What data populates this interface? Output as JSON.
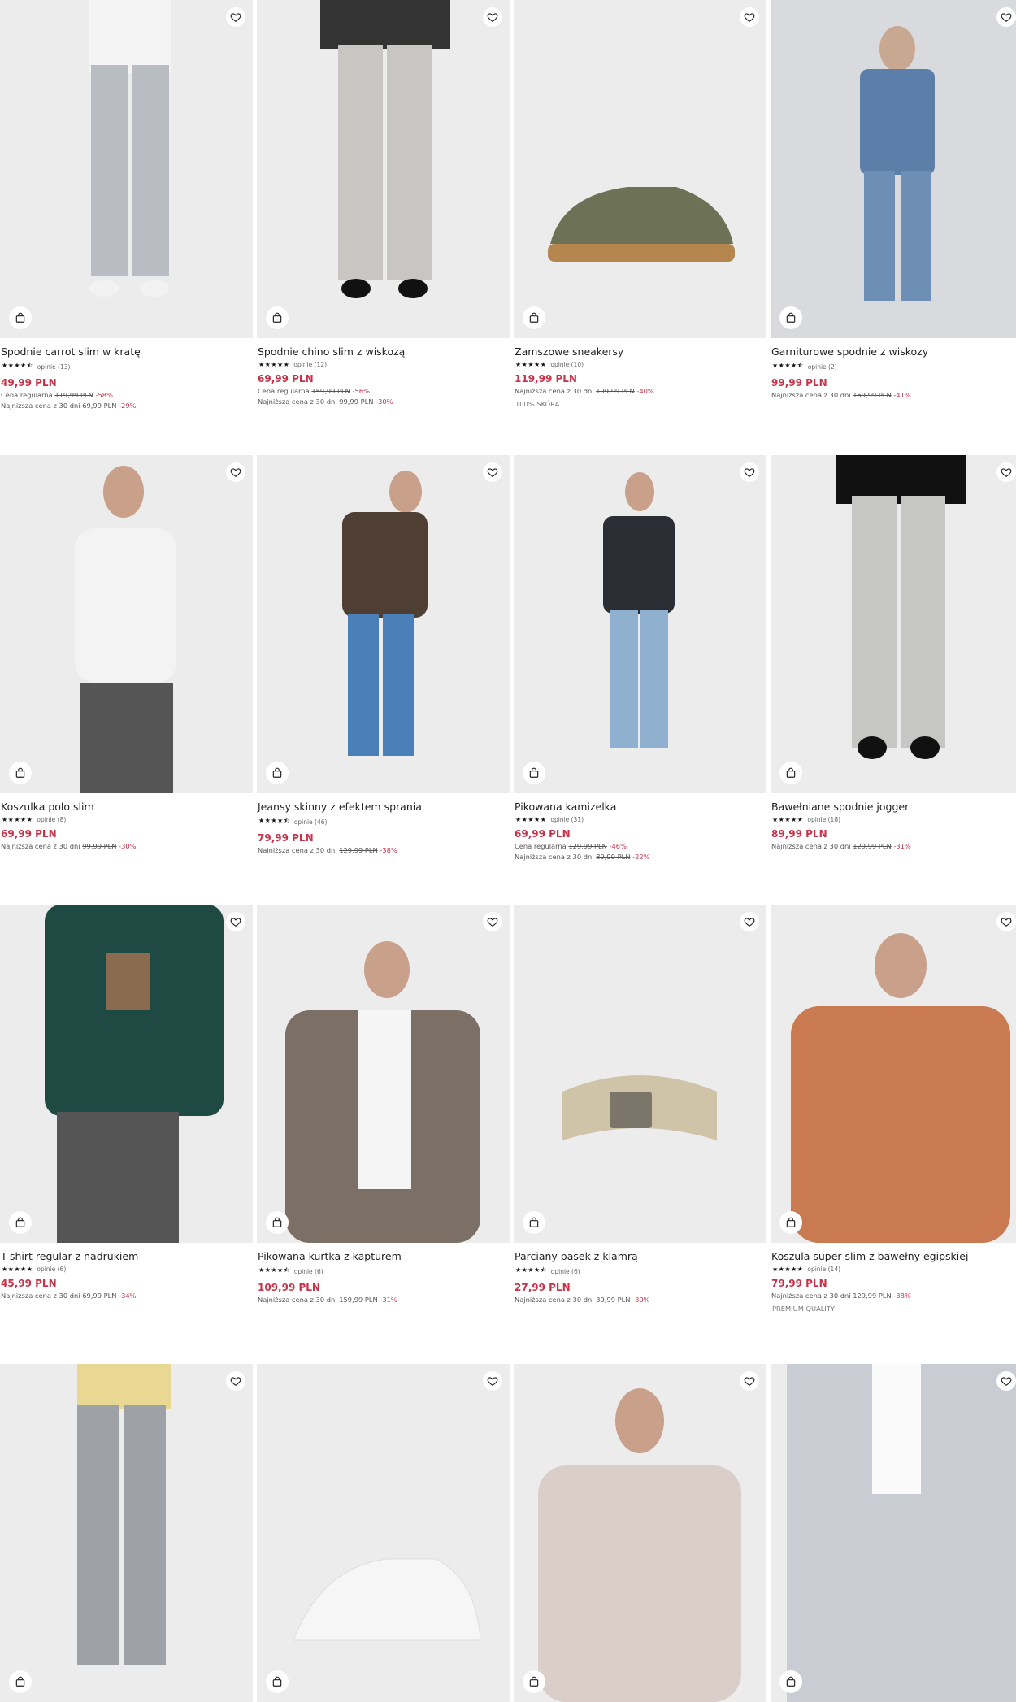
{
  "colors": {
    "price": "#c8334a",
    "discount": "#c8334a",
    "text": "#222222",
    "image_bg": "#ececec"
  },
  "icons": {
    "favorite": "heart-icon",
    "cart": "shopping-bag-icon",
    "rating": "star-icon"
  },
  "products": [
    {
      "name": "Spodnie carrot slim w kratę",
      "stars": "★★★★⯪",
      "reviews": "opinie (13)",
      "price": "49,99 PLN",
      "regular_label": "Cena regularna",
      "regular_old": "119,99 PLN",
      "regular_disc": "-58%",
      "lowest_label": "Najniższa cena z 30 dni",
      "lowest_old": "69,99 PLN",
      "lowest_disc": "-29%",
      "tag": ""
    },
    {
      "name": "Spodnie chino slim z wiskozą",
      "stars": "★★★★★",
      "reviews": "opinie (12)",
      "price": "69,99 PLN",
      "regular_label": "Cena regularna",
      "regular_old": "159,99 PLN",
      "regular_disc": "-56%",
      "lowest_label": "Najniższa cena z 30 dni",
      "lowest_old": "99,99 PLN",
      "lowest_disc": "-30%",
      "tag": ""
    },
    {
      "name": "Zamszowe sneakersy",
      "stars": "★★★★★",
      "reviews": "opinie (10)",
      "price": "119,99 PLN",
      "regular_label": "",
      "regular_old": "",
      "regular_disc": "",
      "lowest_label": "Najniższa cena z 30 dni",
      "lowest_old": "199,99 PLN",
      "lowest_disc": "-40%",
      "tag": "100% SKÓRA"
    },
    {
      "name": "Garniturowe spodnie z wiskozy",
      "stars": "★★★★⯪",
      "reviews": "opinie (2)",
      "price": "99,99 PLN",
      "regular_label": "",
      "regular_old": "",
      "regular_disc": "",
      "lowest_label": "Najniższa cena z 30 dni",
      "lowest_old": "169,99 PLN",
      "lowest_disc": "-41%",
      "tag": ""
    },
    {
      "name": "Koszulka polo slim",
      "stars": "★★★★★",
      "reviews": "opinie (8)",
      "price": "69,99 PLN",
      "regular_label": "",
      "regular_old": "",
      "regular_disc": "",
      "lowest_label": "Najniższa cena z 30 dni",
      "lowest_old": "99,99 PLN",
      "lowest_disc": "-30%",
      "tag": ""
    },
    {
      "name": "Jeansy skinny z efektem sprania",
      "stars": "★★★★⯪",
      "reviews": "opinie (46)",
      "price": "79,99 PLN",
      "regular_label": "",
      "regular_old": "",
      "regular_disc": "",
      "lowest_label": "Najniższa cena z 30 dni",
      "lowest_old": "129,99 PLN",
      "lowest_disc": "-38%",
      "tag": ""
    },
    {
      "name": "Pikowana kamizelka",
      "stars": "★★★★★",
      "reviews": "opinie (31)",
      "price": "69,99 PLN",
      "regular_label": "Cena regularna",
      "regular_old": "129,99 PLN",
      "regular_disc": "-46%",
      "lowest_label": "Najniższa cena z 30 dni",
      "lowest_old": "89,99 PLN",
      "lowest_disc": "-22%",
      "tag": ""
    },
    {
      "name": "Bawełniane spodnie jogger",
      "stars": "★★★★★",
      "reviews": "opinie (18)",
      "price": "89,99 PLN",
      "regular_label": "",
      "regular_old": "",
      "regular_disc": "",
      "lowest_label": "Najniższa cena z 30 dni",
      "lowest_old": "129,99 PLN",
      "lowest_disc": "-31%",
      "tag": ""
    },
    {
      "name": "T-shirt regular z nadrukiem",
      "stars": "★★★★★",
      "reviews": "opinie (6)",
      "price": "45,99 PLN",
      "regular_label": "",
      "regular_old": "",
      "regular_disc": "",
      "lowest_label": "Najniższa cena z 30 dni",
      "lowest_old": "69,99 PLN",
      "lowest_disc": "-34%",
      "tag": ""
    },
    {
      "name": "Pikowana kurtka z kapturem",
      "stars": "★★★★⯪",
      "reviews": "opinie (6)",
      "price": "109,99 PLN",
      "regular_label": "",
      "regular_old": "",
      "regular_disc": "",
      "lowest_label": "Najniższa cena z 30 dni",
      "lowest_old": "159,99 PLN",
      "lowest_disc": "-31%",
      "tag": ""
    },
    {
      "name": "Parciany pasek z klamrą",
      "stars": "★★★★⯪",
      "reviews": "opinie (6)",
      "price": "27,99 PLN",
      "regular_label": "",
      "regular_old": "",
      "regular_disc": "",
      "lowest_label": "Najniższa cena z 30 dni",
      "lowest_old": "39,99 PLN",
      "lowest_disc": "-30%",
      "tag": ""
    },
    {
      "name": "Koszula super slim z bawełny egipskiej",
      "stars": "★★★★★",
      "reviews": "opinie (14)",
      "price": "79,99 PLN",
      "regular_label": "",
      "regular_old": "",
      "regular_disc": "",
      "lowest_label": "Najniższa cena z 30 dni",
      "lowest_old": "129,99 PLN",
      "lowest_disc": "-38%",
      "tag": "PREMIUM QUALITY"
    },
    {
      "name": "",
      "stars": "",
      "reviews": "",
      "price": "",
      "regular_label": "",
      "regular_old": "",
      "regular_disc": "",
      "lowest_label": "",
      "lowest_old": "",
      "lowest_disc": "",
      "tag": ""
    },
    {
      "name": "",
      "stars": "",
      "reviews": "",
      "price": "",
      "regular_label": "",
      "regular_old": "",
      "regular_disc": "",
      "lowest_label": "",
      "lowest_old": "",
      "lowest_disc": "",
      "tag": ""
    },
    {
      "name": "",
      "stars": "",
      "reviews": "",
      "price": "",
      "regular_label": "",
      "regular_old": "",
      "regular_disc": "",
      "lowest_label": "",
      "lowest_old": "",
      "lowest_disc": "",
      "tag": ""
    },
    {
      "name": "",
      "stars": "",
      "reviews": "",
      "price": "",
      "regular_label": "",
      "regular_old": "",
      "regular_disc": "",
      "lowest_label": "",
      "lowest_old": "",
      "lowest_disc": "",
      "tag": ""
    }
  ]
}
